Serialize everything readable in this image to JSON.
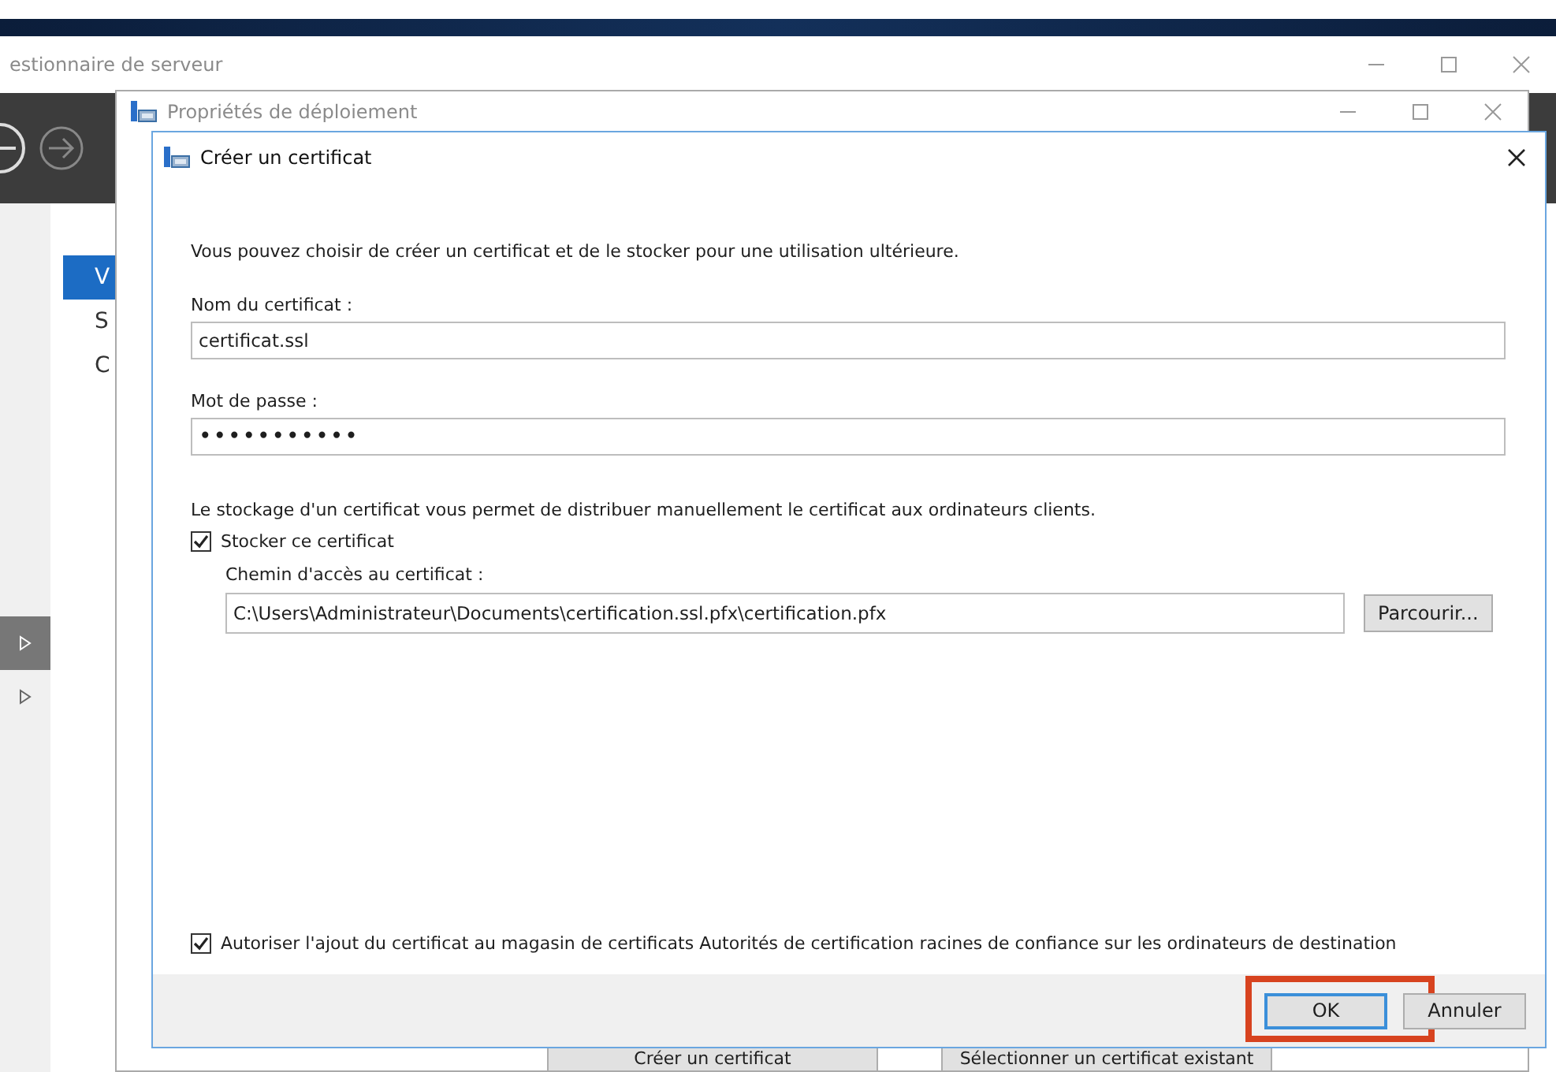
{
  "server_manager": {
    "title": "estionnaire de serveur",
    "sidebar": {
      "items": [
        {
          "label": "V",
          "selected": true
        },
        {
          "label": "S",
          "selected": false
        },
        {
          "label": "C",
          "selected": false
        }
      ]
    },
    "nav_rows": [
      {
        "selected": true
      },
      {
        "selected": false
      }
    ]
  },
  "deployment_window": {
    "title": "Propriétés de déploiement",
    "buttons": [
      {
        "label": "Créer un certificat"
      },
      {
        "label": "Sélectionner un certificat existant"
      }
    ]
  },
  "dialog": {
    "title": "Créer un certificat",
    "intro": "Vous pouvez choisir de créer un certificat et de le stocker pour une utilisation ultérieure.",
    "name_label": "Nom du certificat :",
    "name_value": "certificat.ssl",
    "password_label": "Mot de passe :",
    "password_value": "•••••••••••",
    "storage_note": "Le stockage d'un certificat vous permet de distribuer manuellement le certificat aux ordinateurs clients.",
    "store_checkbox": {
      "label": "Stocker ce certificat",
      "checked": true
    },
    "path_label": "Chemin d'accès au certificat :",
    "path_value": "C:\\Users\\Administrateur\\Documents\\certification.ssl.pfx\\certification.pfx",
    "browse_button": "Parcourir...",
    "trust_checkbox": {
      "label": "Autoriser l'ajout du certificat au magasin de certificats Autorités de certification racines de confiance sur les ordinateurs de destination",
      "checked": true
    },
    "buttons": [
      {
        "label": "OK",
        "default": true,
        "highlighted": true
      },
      {
        "label": "Annuler",
        "default": false,
        "highlighted": false
      }
    ]
  }
}
